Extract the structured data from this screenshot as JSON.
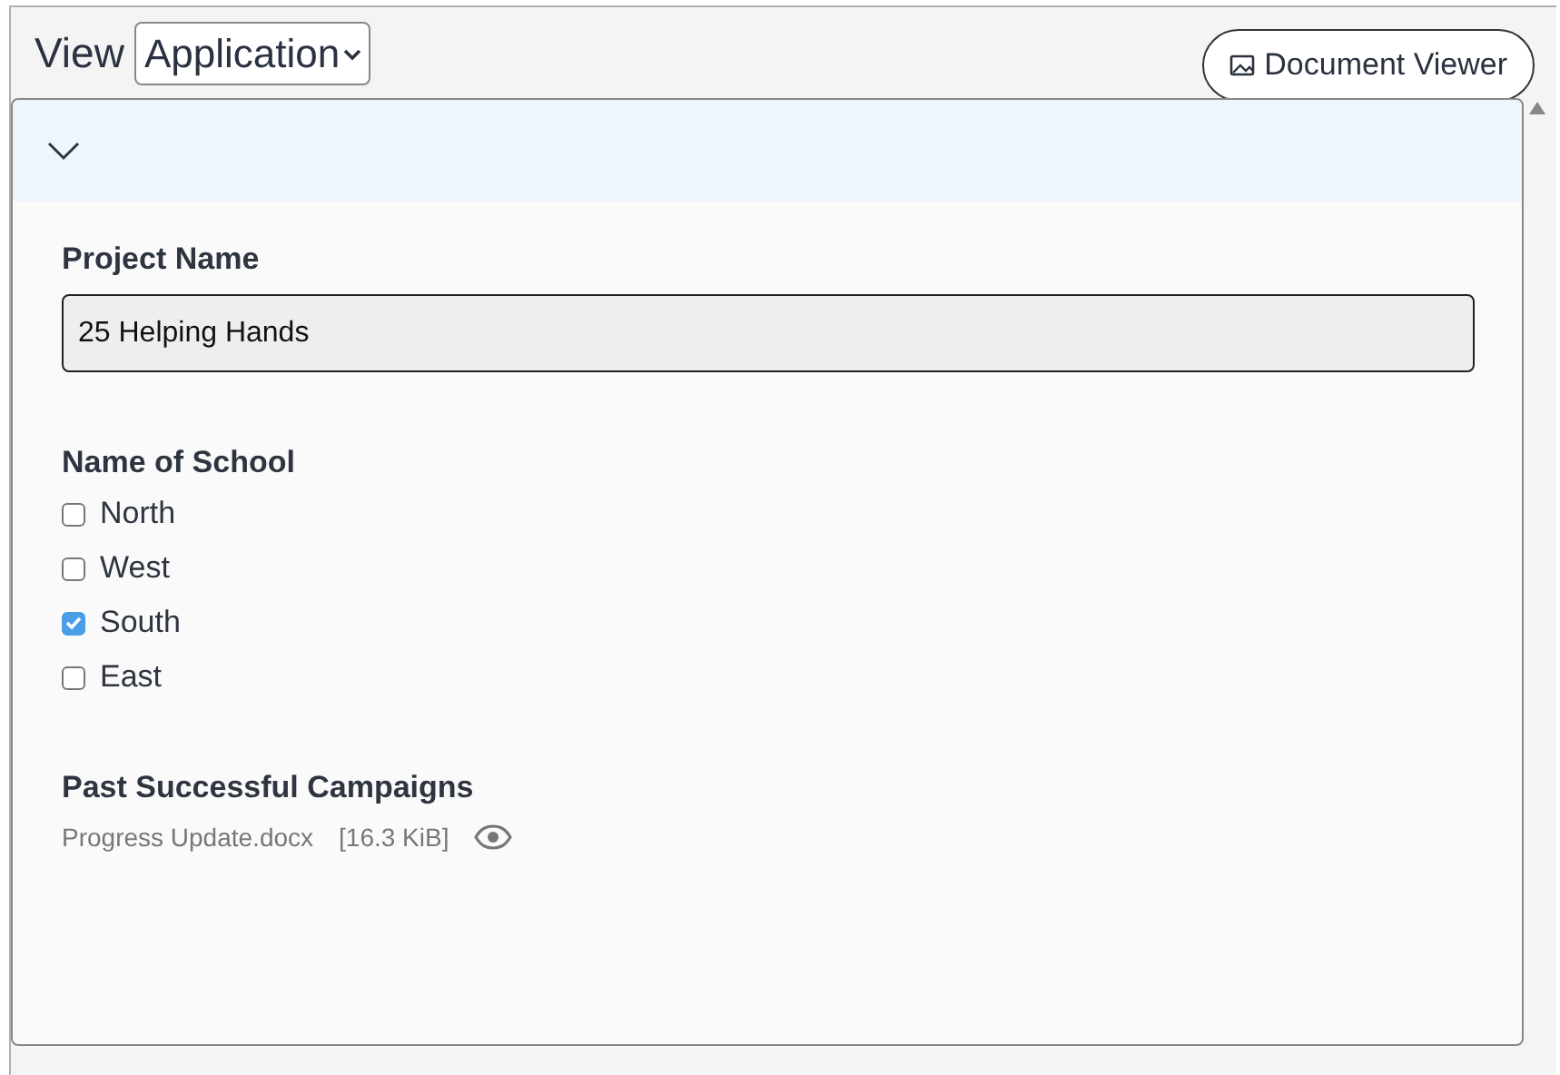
{
  "view": {
    "label": "View",
    "value": "Application"
  },
  "document_viewer_button": {
    "label": "Document Viewer"
  },
  "panel": {
    "expanded": true,
    "fields": [
      {
        "kind": "text",
        "label": "Project Name",
        "value": "25 Helping Hands"
      },
      {
        "kind": "checkboxes",
        "label": "Name of School",
        "options": [
          {
            "label": "North",
            "checked": false
          },
          {
            "label": "West",
            "checked": false
          },
          {
            "label": "South",
            "checked": true
          },
          {
            "label": "East",
            "checked": false
          }
        ]
      },
      {
        "kind": "files",
        "label": "Past Successful Campaigns",
        "files": [
          {
            "name": "Progress Update.docx",
            "size": "[16.3 KiB]"
          }
        ]
      }
    ]
  }
}
